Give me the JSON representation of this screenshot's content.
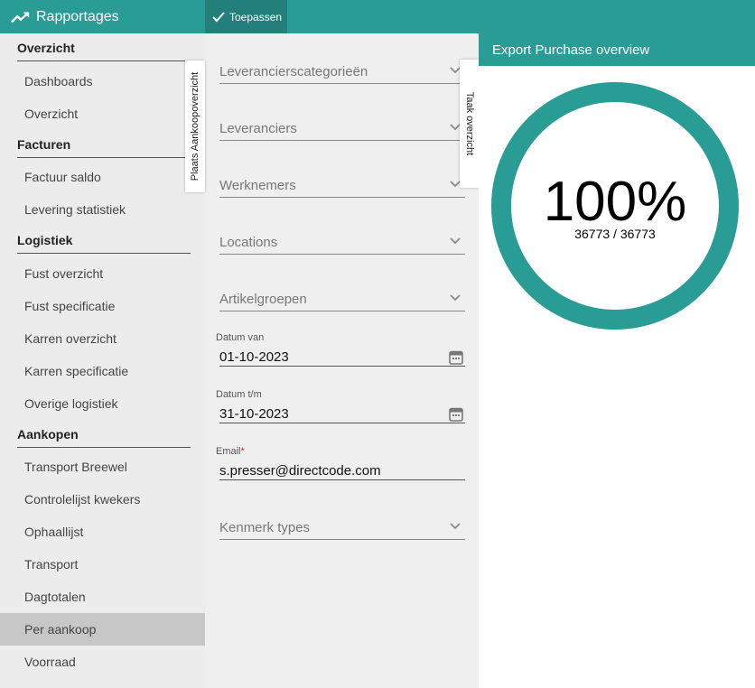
{
  "app": {
    "title": "Rapportages",
    "apply_label": "Toepassen"
  },
  "sidebar": {
    "sections": [
      {
        "title": "Overzicht",
        "items": [
          "Dashboards",
          "Overzicht"
        ]
      },
      {
        "title": "Facturen",
        "items": [
          "Factuur saldo",
          "Levering statistiek"
        ]
      },
      {
        "title": "Logistiek",
        "items": [
          "Fust overzicht",
          "Fust specificatie",
          "Karren overzicht",
          "Karren specificatie",
          "Overige logistiek"
        ]
      },
      {
        "title": "Aankopen",
        "items": [
          "Transport Breewel",
          "Controlelijst kwekers",
          "Ophaallijst",
          "Transport",
          "Dagtotalen",
          "Per aankoop",
          "Voorraad"
        ]
      }
    ],
    "active_item": "Per aankoop"
  },
  "side_tabs": {
    "left": "Plaats Aankoopoverzicht",
    "right": "Taak overzicht"
  },
  "form": {
    "selects": [
      "Leverancierscategorieën",
      "Leveranciers",
      "Werknemers",
      "Locations",
      "Artikelgroepen"
    ],
    "date_from": {
      "label": "Datum van",
      "value": "01-10-2023"
    },
    "date_to": {
      "label": "Datum t/m",
      "value": "31-10-2023"
    },
    "email": {
      "label": "Email",
      "required_mark": "*",
      "value": "s.presser@directcode.com"
    },
    "kenmerk_label": "Kenmerk types"
  },
  "export": {
    "title": "Export Purchase overview",
    "percent_text": "100%",
    "progress": 1.0,
    "count_text": "36773 / 36773"
  },
  "colors": {
    "accent": "#2a9c96",
    "accent_dark": "#237f7a",
    "required": "#d32f2f"
  },
  "icons": {
    "brand": "trending-up-icon",
    "apply": "check-icon",
    "select": "chevron-down-icon",
    "date": "calendar-icon"
  }
}
